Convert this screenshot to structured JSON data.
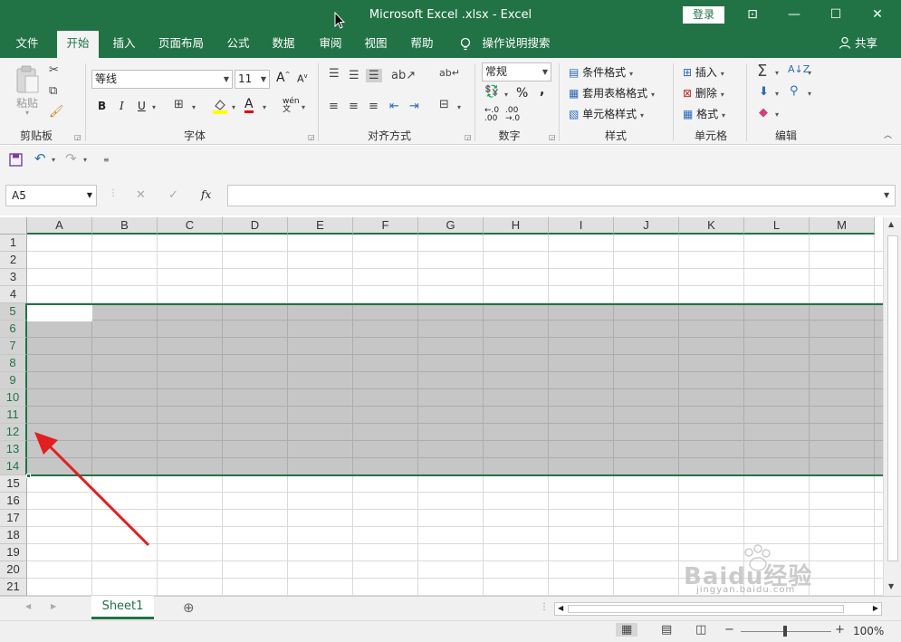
{
  "window": {
    "title": "Microsoft Excel .xlsx  -  Excel",
    "login": "登录",
    "controls": [
      "⊡",
      "—",
      "☐",
      "✕"
    ]
  },
  "tabs": {
    "items": [
      "文件",
      "开始",
      "插入",
      "页面布局",
      "公式",
      "数据",
      "审阅",
      "视图",
      "帮助"
    ],
    "active": "开始",
    "tell_me": "操作说明搜索",
    "share": "共享"
  },
  "ribbon": {
    "clipboard": {
      "label": "剪贴板",
      "paste": "粘贴"
    },
    "font": {
      "label": "字体",
      "name": "等线",
      "size": "11",
      "bold": "B",
      "italic": "I",
      "underline": "U",
      "grow": "A",
      "shrink": "A"
    },
    "alignment": {
      "label": "对齐方式"
    },
    "number": {
      "label": "数字",
      "format": "常规",
      "percent": "%",
      "comma": ","
    },
    "styles": {
      "label": "样式",
      "conditional": "条件格式",
      "table": "套用表格格式",
      "cell_styles": "单元格样式"
    },
    "cells": {
      "label": "单元格",
      "insert": "插入",
      "delete": "删除",
      "format": "格式"
    },
    "editing": {
      "label": "编辑"
    }
  },
  "formula_bar": {
    "name_box": "A5",
    "fx": "fx",
    "formula": ""
  },
  "grid": {
    "columns": [
      "A",
      "B",
      "C",
      "D",
      "E",
      "F",
      "G",
      "H",
      "I",
      "J",
      "K",
      "L",
      "M"
    ],
    "rows": [
      "1",
      "2",
      "3",
      "4",
      "5",
      "6",
      "7",
      "8",
      "9",
      "10",
      "11",
      "12",
      "13",
      "14",
      "15",
      "16",
      "17",
      "18",
      "19",
      "20",
      "21"
    ],
    "selected_rows": [
      "5",
      "6",
      "7",
      "8",
      "9",
      "10",
      "11",
      "12",
      "13",
      "14"
    ],
    "active_cell": "A5"
  },
  "sheets": {
    "tabs": [
      "Sheet1"
    ],
    "active": "Sheet1"
  },
  "status": {
    "zoom": "100%"
  },
  "watermark": {
    "text": "Baidu经验",
    "url": "jingyan.baidu.com"
  },
  "colors": {
    "excel_green": "#217346",
    "selection": "#c6c6c6",
    "arrow": "#e02020"
  }
}
